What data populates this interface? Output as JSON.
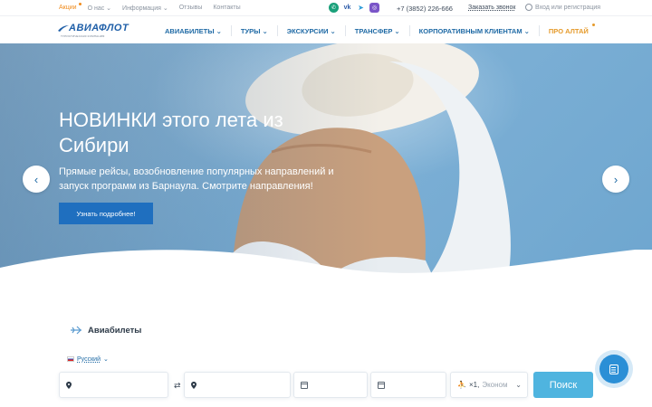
{
  "topbar": {
    "links": [
      {
        "label": "Акции",
        "promo": true
      },
      {
        "label": "О нас",
        "dropdown": true
      },
      {
        "label": "Информация",
        "dropdown": true
      },
      {
        "label": "Отзывы",
        "dropdown": false
      },
      {
        "label": "Контакты",
        "dropdown": false
      }
    ],
    "social_icons": [
      "whatsapp-icon",
      "vk-icon",
      "telegram-icon",
      "viber-icon"
    ],
    "phone": "+7 (3852) 226-666",
    "callback_label": "Заказать звонок",
    "login_label": "Вход или регистрация"
  },
  "nav": {
    "logo_text": "АВИАФЛОТ",
    "logo_subtitle": "ТУРИСТИЧЕСКАЯ КОМПАНИЯ",
    "items": [
      {
        "label": "АВИАБИЛЕТЫ"
      },
      {
        "label": "ТУРЫ"
      },
      {
        "label": "ЭКСКУРСИИ"
      },
      {
        "label": "ТРАНСФЕР"
      },
      {
        "label": "КОРПОРАТИВНЫМ КЛИЕНТАМ"
      },
      {
        "label": "ПРО АЛТАЙ"
      }
    ]
  },
  "hero": {
    "title": "НОВИНКИ этого лета из Сибири",
    "subtitle": "Прямые рейсы, возобновление популярных направлений и запуск программ из Барнаула. Смотрите направления!",
    "button_label": "Узнать подробнее!"
  },
  "search": {
    "tab_label": "Авиабилеты",
    "language_label": "Русский",
    "passengers_count": "×1,",
    "passengers_class": "Эконом",
    "submit_label": "Поиск"
  },
  "colors": {
    "brand_blue": "#1f6aa5",
    "accent_orange": "#f08c1e",
    "search_button": "#4fb4df",
    "hero_button": "#1f6fbf"
  }
}
